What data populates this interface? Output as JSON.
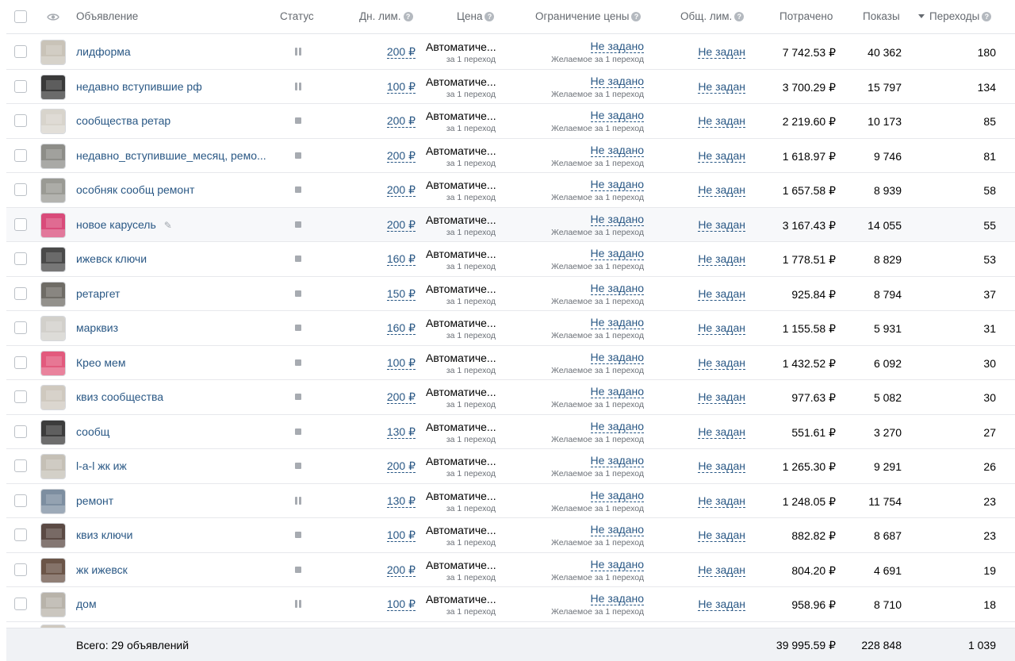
{
  "header": {
    "ad": "Объявление",
    "status": "Статус",
    "daily_limit": "Дн. лим.",
    "price": "Цена",
    "price_limit": "Ограничение цены",
    "total_limit": "Общ. лим.",
    "spent": "Потрачено",
    "impressions": "Показы",
    "clicks": "Переходы",
    "help_glyph": "?"
  },
  "common": {
    "price_mode": "Автоматиче...",
    "price_per": "за 1 переход",
    "price_limit_value": "Не задано",
    "price_limit_desc": "Желаемое за 1 переход",
    "total_limit_value": "Не задан",
    "edit_glyph": "✎"
  },
  "rows": [
    {
      "name": "лидформа",
      "status": "paused",
      "daily": "200 ₽",
      "spent": "7 742.53 ₽",
      "shows": "40 362",
      "clicks": "180",
      "thumb": "#c9c3b8"
    },
    {
      "name": "недавно вступившие рф",
      "status": "paused",
      "daily": "100 ₽",
      "spent": "3 700.29 ₽",
      "shows": "15 797",
      "clicks": "134",
      "thumb": "#3a3a3a"
    },
    {
      "name": "сообщества ретар",
      "status": "stopped",
      "daily": "200 ₽",
      "spent": "2 219.60 ₽",
      "shows": "10 173",
      "clicks": "85",
      "thumb": "#d8d4cc"
    },
    {
      "name": "недавно_вступившие_месяц, ремо...",
      "status": "stopped",
      "daily": "200 ₽",
      "spent": "1 618.97 ₽",
      "shows": "9 746",
      "clicks": "81",
      "thumb": "#8d8d88"
    },
    {
      "name": "особняк сообщ ремонт",
      "status": "stopped",
      "daily": "200 ₽",
      "spent": "1 657.58 ₽",
      "shows": "8 939",
      "clicks": "58",
      "thumb": "#9a9a94"
    },
    {
      "name": "новое карусель",
      "status": "stopped",
      "daily": "200 ₽",
      "spent": "3 167.43 ₽",
      "shows": "14 055",
      "clicks": "55",
      "thumb": "#d94b7a",
      "editable": true
    },
    {
      "name": "ижевск ключи",
      "status": "stopped",
      "daily": "160 ₽",
      "spent": "1 778.51 ₽",
      "shows": "8 829",
      "clicks": "53",
      "thumb": "#4a4a4a"
    },
    {
      "name": "ретаргет",
      "status": "stopped",
      "daily": "150 ₽",
      "spent": "925.84 ₽",
      "shows": "8 794",
      "clicks": "37",
      "thumb": "#6f6c66"
    },
    {
      "name": "марквиз",
      "status": "stopped",
      "daily": "160 ₽",
      "spent": "1 155.58 ₽",
      "shows": "5 931",
      "clicks": "31",
      "thumb": "#d2d0cb"
    },
    {
      "name": "Крео мем",
      "status": "stopped",
      "daily": "100 ₽",
      "spent": "1 432.52 ₽",
      "shows": "6 092",
      "clicks": "30",
      "thumb": "#e25a7d"
    },
    {
      "name": "квиз сообщества",
      "status": "stopped",
      "daily": "200 ₽",
      "spent": "977.63 ₽",
      "shows": "5 082",
      "clicks": "30",
      "thumb": "#cfc9bf"
    },
    {
      "name": "сообщ",
      "status": "stopped",
      "daily": "130 ₽",
      "spent": "551.61 ₽",
      "shows": "3 270",
      "clicks": "27",
      "thumb": "#3c3c3c"
    },
    {
      "name": "l-a-l жк иж",
      "status": "stopped",
      "daily": "200 ₽",
      "spent": "1 265.30 ₽",
      "shows": "9 291",
      "clicks": "26",
      "thumb": "#c5c0b6"
    },
    {
      "name": "ремонт",
      "status": "paused",
      "daily": "130 ₽",
      "spent": "1 248.05 ₽",
      "shows": "11 754",
      "clicks": "23",
      "thumb": "#7d8ea0"
    },
    {
      "name": "квиз ключи",
      "status": "stopped",
      "daily": "100 ₽",
      "spent": "882.82 ₽",
      "shows": "8 687",
      "clicks": "23",
      "thumb": "#5b4a44"
    },
    {
      "name": "жк ижевск",
      "status": "stopped",
      "daily": "200 ₽",
      "spent": "804.20 ₽",
      "shows": "4 691",
      "clicks": "19",
      "thumb": "#6b5548"
    },
    {
      "name": "дом",
      "status": "paused",
      "daily": "100 ₽",
      "spent": "958.96 ₽",
      "shows": "8 710",
      "clicks": "18",
      "thumb": "#b8b3aa"
    }
  ],
  "footer": {
    "total_label": "Всего: 29 объявлений",
    "spent": "39 995.59 ₽",
    "shows": "228 848",
    "clicks": "1 039"
  },
  "colors": {
    "link": "#2a5885",
    "header_text": "#656a70",
    "status_icon": "#a7abb1",
    "footer_bg": "#f0f2f5"
  },
  "icons": {
    "visibility_column": "eye-icon",
    "sort_direction": "sort-desc-icon",
    "help": "question-circle-icon",
    "status_paused": "pause-icon",
    "status_stopped": "stop-icon",
    "edit": "pencil-icon"
  }
}
